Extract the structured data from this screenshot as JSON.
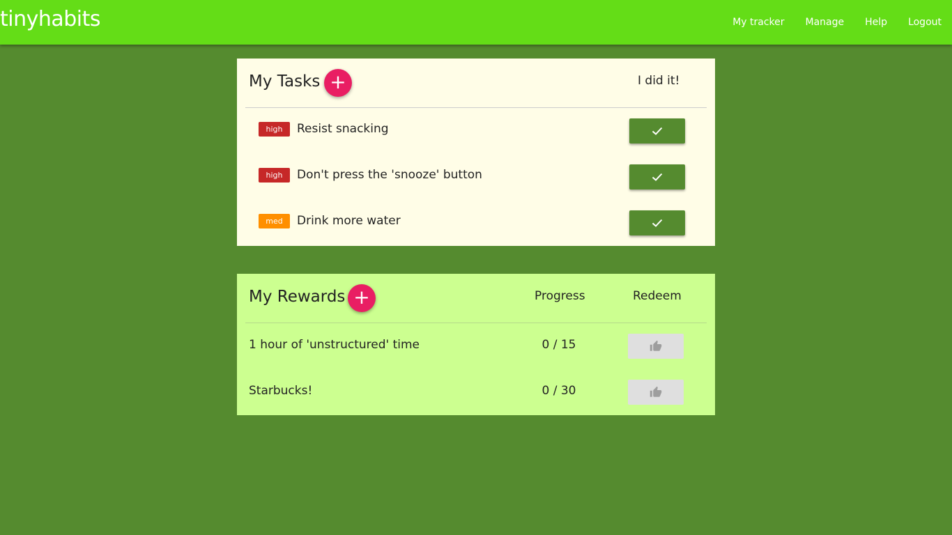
{
  "app": {
    "brand": "tinyhabits"
  },
  "nav": [
    {
      "label": "My tracker"
    },
    {
      "label": "Manage"
    },
    {
      "label": "Help"
    },
    {
      "label": "Logout"
    }
  ],
  "tasks": {
    "title": "My Tasks",
    "add_label": "+",
    "done_header": "I did it!",
    "items": [
      {
        "priority": "high",
        "name": "Resist snacking"
      },
      {
        "priority": "high",
        "name": "Don't press the 'snooze' button"
      },
      {
        "priority": "med",
        "name": "Drink more water"
      }
    ]
  },
  "rewards": {
    "title": "My Rewards",
    "add_label": "+",
    "progress_header": "Progress",
    "redeem_header": "Redeem",
    "items": [
      {
        "name": "1 hour of 'unstructured' time",
        "progress": "0 / 15"
      },
      {
        "name": "Starbucks!",
        "progress": "0 / 30"
      }
    ]
  },
  "icons": {
    "task_done": "check-icon",
    "reward_redeem": "thumbs-up-icon",
    "add": "plus-icon"
  },
  "colors": {
    "topbar": "#64dd17",
    "background": "#558b2f",
    "tasks_card": "#fffde7",
    "rewards_card": "#ccff90",
    "add_button": "#e91e63",
    "priority_high": "#c62828",
    "priority_med": "#ff8f00",
    "done_button": "#558b2f",
    "redeem_button_disabled": "#dfdfdf"
  }
}
